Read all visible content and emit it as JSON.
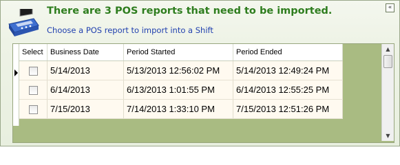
{
  "header": {
    "title": "There are 3 POS reports that need to be imported.",
    "subtitle": "Choose a POS report to import into a Shift",
    "collapse_glyph": "«",
    "icon": "cash-register-icon"
  },
  "grid": {
    "columns": [
      "Select",
      "Business Date",
      "Period Started",
      "Period Ended"
    ],
    "rows": [
      {
        "business_date": "5/14/2013",
        "period_started": "5/13/2013 12:56:02 PM",
        "period_ended": "5/14/2013 12:49:24 PM"
      },
      {
        "business_date": "6/14/2013",
        "period_started": "6/13/2013 1:01:55 PM",
        "period_ended": "6/14/2013 12:55:25 PM"
      },
      {
        "business_date": "7/15/2013",
        "period_started": "7/14/2013 1:33:10 PM",
        "period_ended": "7/15/2013 12:51:26 PM"
      }
    ]
  },
  "colors": {
    "title": "#2e7d1e",
    "subtitle": "#1f3fae",
    "grid_bg": "#a9bb82",
    "row_bg": "#fffaf0"
  }
}
